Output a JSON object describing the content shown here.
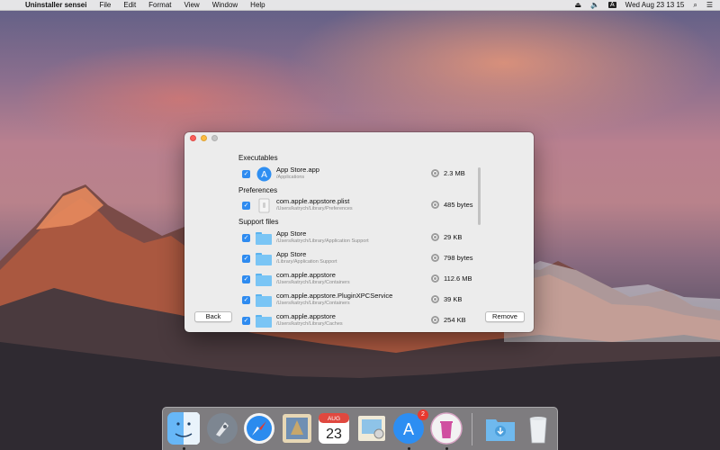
{
  "menubar": {
    "app_name": "Uninstaller sensei",
    "menus": [
      "File",
      "Edit",
      "Format",
      "View",
      "Window",
      "Help"
    ],
    "input_source": "A",
    "clock": "Wed Aug 23  13 15"
  },
  "window": {
    "sections": [
      {
        "title": "Executables"
      },
      {
        "title": "Preferences"
      },
      {
        "title": "Support files"
      }
    ],
    "rows": [
      {
        "name": "App Store.app",
        "path": "/Applications",
        "size": "2.3 MB",
        "checked": true,
        "icon": "app-store-icon"
      },
      {
        "name": "com.apple.appstore.plist",
        "path": "/Users/katrych/Library/Preferences",
        "size": "485 bytes",
        "checked": true,
        "icon": "plist-file-icon"
      },
      {
        "name": "App Store",
        "path": "/Users/katrych/Library/Application Support",
        "size": "29 KB",
        "checked": true,
        "icon": "folder-icon"
      },
      {
        "name": "App Store",
        "path": "/Library/Application Support",
        "size": "798 bytes",
        "checked": true,
        "icon": "folder-icon"
      },
      {
        "name": "com.apple.appstore",
        "path": "/Users/katrych/Library/Containers",
        "size": "112.6 MB",
        "checked": true,
        "icon": "folder-icon"
      },
      {
        "name": "com.apple.appstore.PluginXPCService",
        "path": "/Users/katrych/Library/Containers",
        "size": "39 KB",
        "checked": true,
        "icon": "folder-icon"
      },
      {
        "name": "com.apple.appstore",
        "path": "/Users/katrych/Library/Caches",
        "size": "254 KB",
        "checked": true,
        "icon": "folder-icon"
      }
    ],
    "back_label": "Back",
    "remove_label": "Remove"
  },
  "dock": {
    "items": [
      "finder-icon",
      "launchpad-icon",
      "safari-icon",
      "mail-icon",
      "calendar-icon",
      "preview-icon",
      "app-store-icon",
      "uninstaller-icon",
      "downloads-folder-icon",
      "trash-icon"
    ],
    "calendar_month": "AUG",
    "calendar_day": "23",
    "app_store_badge": "2"
  }
}
